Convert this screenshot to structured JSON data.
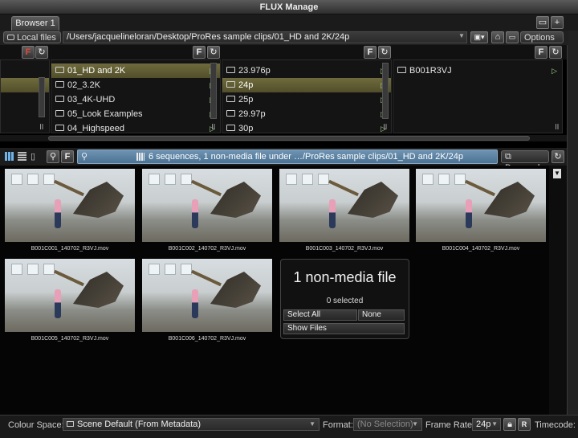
{
  "window": {
    "title": "FLUX Manage"
  },
  "tabs": [
    {
      "label": "Browser 1"
    }
  ],
  "pathbar": {
    "source_label": "Local files",
    "path": "/Users/jacquelineloran/Desktop/ProRes sample clips/01_HD and 2K/24p",
    "options_label": "Options"
  },
  "columns": [
    {
      "items": []
    },
    {
      "items": [
        {
          "label": "01_HD and 2K",
          "selected": true
        },
        {
          "label": "02_3.2K",
          "selected": false
        },
        {
          "label": "03_4K-UHD",
          "selected": false
        },
        {
          "label": "05_Look Examples",
          "selected": false
        },
        {
          "label": "04_Highspeed",
          "selected": false
        }
      ]
    },
    {
      "items": [
        {
          "label": "23.976p",
          "selected": false
        },
        {
          "label": "24p",
          "selected": true
        },
        {
          "label": "25p",
          "selected": false
        },
        {
          "label": "29.97p",
          "selected": false
        },
        {
          "label": "30p",
          "selected": false
        }
      ]
    },
    {
      "items": [
        {
          "label": "B001R3VJ",
          "selected": false
        }
      ]
    }
  ],
  "toolbar": {
    "info_text": "6 sequences, 1 non-media file under …/ProRes sample clips/01_HD and 2K/24p",
    "sort_label": "Descend"
  },
  "clips": [
    {
      "name": "B001C001_140702_R3VJ.mov"
    },
    {
      "name": "B001C002_140702_R3VJ.mov"
    },
    {
      "name": "B001C003_140702_R3VJ.mov"
    },
    {
      "name": "B001C004_140702_R3VJ.mov"
    },
    {
      "name": "B001C005_140702_R3VJ.mov"
    },
    {
      "name": "B001C006_140702_R3VJ.mov"
    }
  ],
  "nonmedia": {
    "title": "1 non-media file",
    "selected_text": "0 selected",
    "select_all_label": "Select All",
    "none_label": "None",
    "show_files_label": "Show Files"
  },
  "bottom": {
    "colour_space_label": "Colour Space:",
    "colour_space_value": "Scene Default (From Metadata)",
    "format_label": "Format:",
    "format_value": "(No Selection)",
    "frame_rate_label": "Frame Rate:",
    "frame_rate_value": "24p",
    "timecode_label": "Timecode:"
  },
  "colors": {
    "accent_blue": "#5b7fa0",
    "folder_selected": "#625e35",
    "flux_red": "#d23a2a"
  }
}
